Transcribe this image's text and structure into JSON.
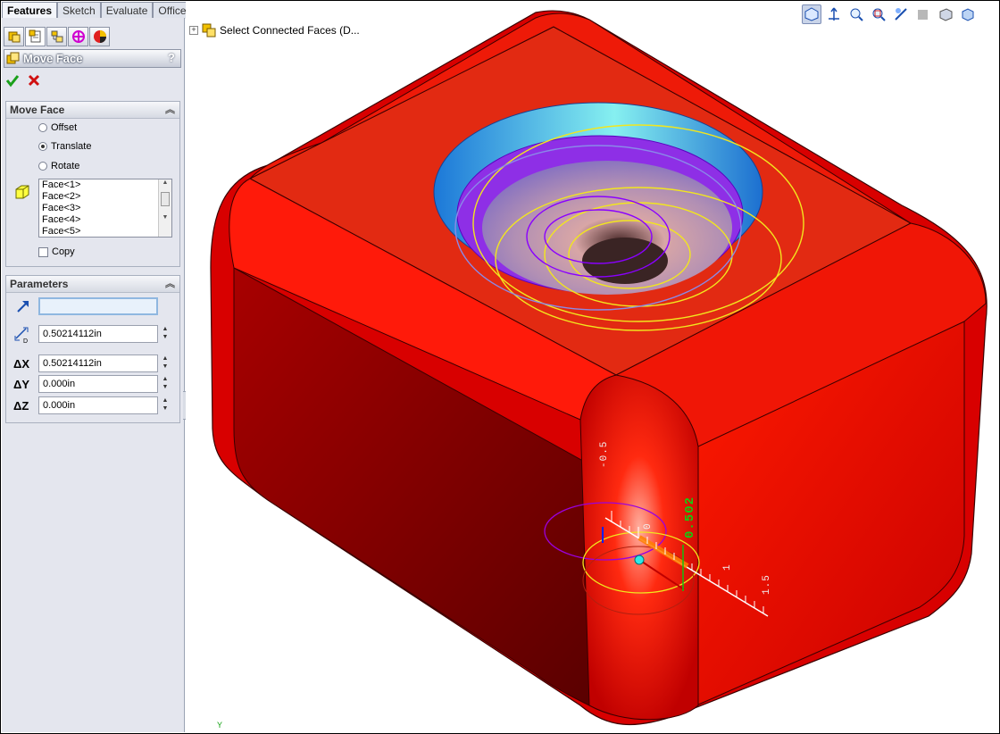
{
  "tabs": [
    "Features",
    "Sketch",
    "Evaluate",
    "Office Products"
  ],
  "active_tab": "Features",
  "icon_bar": [
    "feature-manager-icon",
    "property-manager-icon",
    "configuration-manager-icon",
    "dimxpert-icon",
    "display-manager-icon"
  ],
  "property_manager": {
    "title": "Move Face",
    "help": "?",
    "ok_icon": "green-checkmark-icon",
    "cancel_icon": "red-x-icon"
  },
  "move_face_group": {
    "header": "Move Face",
    "options": [
      "Offset",
      "Translate",
      "Rotate"
    ],
    "selected_option": "Translate",
    "faces": [
      "Face<1>",
      "Face<2>",
      "Face<3>",
      "Face<4>",
      "Face<5>"
    ],
    "copy_label": "Copy",
    "copy_checked": false
  },
  "parameters_group": {
    "header": "Parameters",
    "direction_value": "",
    "distance": "0.50214112in",
    "dx_label": "ΔX",
    "dx": "0.50214112in",
    "dy_label": "ΔY",
    "dy": "0.000in",
    "dz_label": "ΔZ",
    "dz": "0.000in"
  },
  "tree": {
    "item": "Select Connected Faces  (D..."
  },
  "triad_ruler": {
    "labels": [
      "-0.5",
      "0",
      "1",
      "1.5"
    ],
    "current_value": "0.502"
  },
  "axis_label": "Y",
  "colors": {
    "body_red": "#e00000",
    "top_face": "#e02a10",
    "pane_bg": "#e4e6ee",
    "accent_blue": "#2a86e0"
  }
}
